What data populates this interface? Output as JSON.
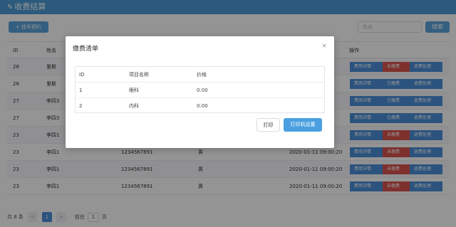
{
  "page": {
    "title": "收费结算",
    "title_icon": "edit-icon"
  },
  "toolbar": {
    "add_label": "+ 挂号预约",
    "search_placeholder": "姓名",
    "search_label": "搜索"
  },
  "table": {
    "headers": {
      "id": "ID",
      "name": "姓名",
      "phone": "",
      "sex": "",
      "time": "",
      "ops": "操作"
    },
    "rows": [
      {
        "id": "28",
        "name": "里斯",
        "phone": "",
        "sex": "",
        "time": "",
        "status": "unpaid"
      },
      {
        "id": "28",
        "name": "里斯",
        "phone": "",
        "sex": "",
        "time": "",
        "status": "paid"
      },
      {
        "id": "27",
        "name": "李四3",
        "phone": "",
        "sex": "",
        "time": "",
        "status": "paid"
      },
      {
        "id": "27",
        "name": "李四3",
        "phone": "",
        "sex": "",
        "time": "",
        "status": "paid"
      },
      {
        "id": "23",
        "name": "李四1",
        "phone": "",
        "sex": "",
        "time": "",
        "status": "unpaid"
      },
      {
        "id": "23",
        "name": "李四1",
        "phone": "1234567891",
        "sex": "男",
        "time": "2020-01-11 09:00:20",
        "status": "unpaid"
      },
      {
        "id": "23",
        "name": "李四1",
        "phone": "1234567891",
        "sex": "男",
        "time": "2020-01-11 09:00:20",
        "status": "unpaid"
      },
      {
        "id": "23",
        "name": "李四1",
        "phone": "1234567891",
        "sex": "男",
        "time": "2020-01-11 09:00:20",
        "status": "unpaid"
      }
    ],
    "ops": {
      "detail": "费用详情",
      "unpaid": "未缴费",
      "paid": "已缴费",
      "refund": "退费处理"
    }
  },
  "pager": {
    "total": "共 8 条",
    "prev": "<",
    "page": "1",
    "next": ">",
    "goto_label": "前往",
    "goto_value": "1",
    "goto_suffix": "页"
  },
  "modal": {
    "title": "缴费清单",
    "close": "×",
    "headers": {
      "id": "ID",
      "name": "项目名称",
      "price": "价格"
    },
    "rows": [
      {
        "id": "1",
        "name": "眼科",
        "price": "0.00"
      },
      {
        "id": "2",
        "name": "内科",
        "price": "0.00"
      }
    ],
    "print_label": "打印",
    "printer_settings_label": "打印机设置"
  },
  "colors": {
    "header_bar": "#4a9bd6",
    "primary": "#4a90d9",
    "danger": "#d9534f"
  }
}
